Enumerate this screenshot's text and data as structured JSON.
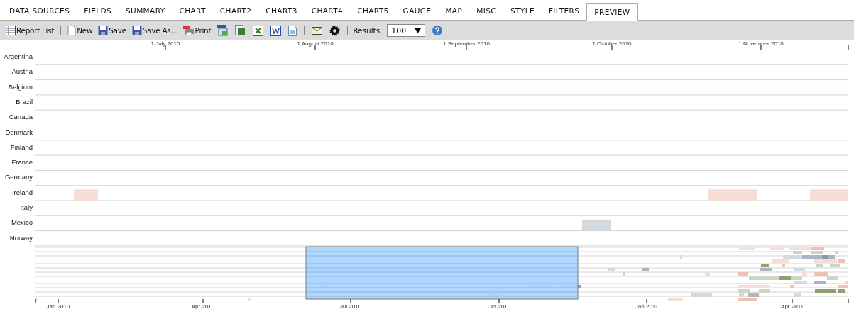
{
  "tabs": [
    {
      "label": "DATA SOURCES",
      "selected": false
    },
    {
      "label": "FIELDS",
      "selected": false
    },
    {
      "label": "SUMMARY",
      "selected": false
    },
    {
      "label": "CHART",
      "selected": false
    },
    {
      "label": "CHART2",
      "selected": false
    },
    {
      "label": "CHART3",
      "selected": false
    },
    {
      "label": "CHART4",
      "selected": false
    },
    {
      "label": "CHART5",
      "selected": false
    },
    {
      "label": "GAUGE",
      "selected": false
    },
    {
      "label": "MAP",
      "selected": false
    },
    {
      "label": "MISC",
      "selected": false
    },
    {
      "label": "STYLE",
      "selected": false
    },
    {
      "label": "FILTERS",
      "selected": false
    },
    {
      "label": "PREVIEW",
      "selected": true
    }
  ],
  "toolbar": {
    "buttons": [
      {
        "kind": "list",
        "label": "Report List"
      },
      {
        "kind": "new",
        "label": "New"
      },
      {
        "kind": "save",
        "label": "Save"
      },
      {
        "kind": "saveas",
        "label": "Save As..."
      },
      {
        "kind": "print",
        "label": "Print"
      }
    ],
    "results": {
      "label": "Results",
      "value": "100"
    }
  },
  "timeline": {
    "axis_top": [
      "1 July 2010",
      "1 August 2010",
      "1 September 2010",
      "1 October 2010",
      "1 November 2010"
    ],
    "lanes": [
      {
        "label": "Argentina"
      },
      {
        "label": "Austria"
      },
      {
        "label": "Belgium"
      },
      {
        "label": "Brazil"
      },
      {
        "label": "Canada"
      },
      {
        "label": "Denmark"
      },
      {
        "label": "Finland"
      },
      {
        "label": "France"
      },
      {
        "label": "Germany"
      },
      {
        "label": "Ireland",
        "color": "#f6ded6"
      },
      {
        "label": "Italy"
      },
      {
        "label": "Mexico",
        "color": "#d3d9dd"
      },
      {
        "label": "Norway"
      }
    ],
    "axis_bottom": [
      "Jan 2010",
      "Apr 2010",
      "Jul 2010",
      "Oct 2010",
      "Jan 2011",
      "Apr 2011"
    ]
  }
}
